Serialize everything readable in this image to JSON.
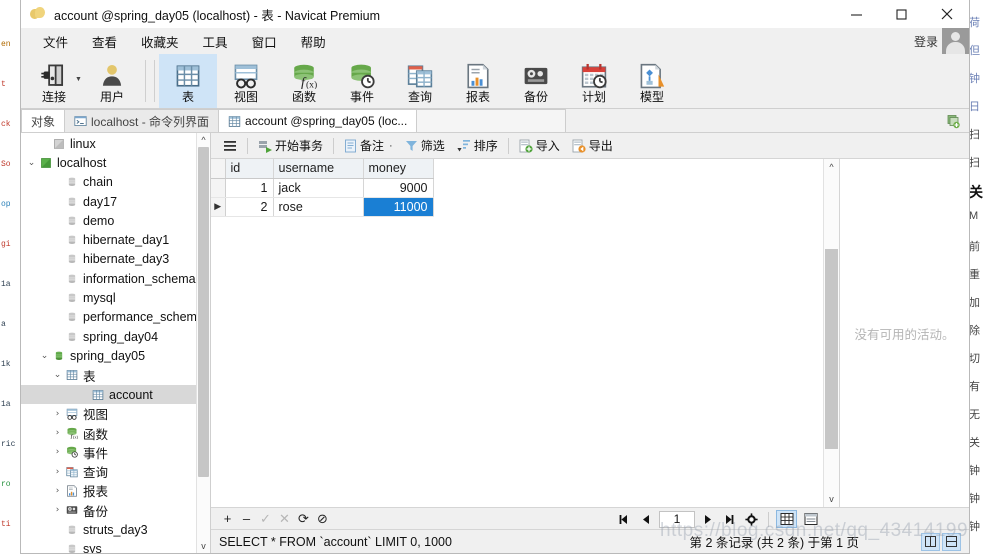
{
  "window": {
    "title": "account @spring_day05 (localhost) - 表 - Navicat Premium",
    "app_icon": "navicat-logo-icon",
    "minimize": "–",
    "maximize": "□",
    "close": "✕"
  },
  "menubar": {
    "items": [
      "文件",
      "查看",
      "收藏夹",
      "工具",
      "窗口",
      "帮助"
    ],
    "login_label": "登录",
    "avatar": "user-avatar-icon"
  },
  "ribbon": {
    "items": [
      {
        "label": "连接",
        "icon": "connection-icon",
        "selected": false,
        "has_caret": true
      },
      {
        "label": "用户",
        "icon": "user-icon",
        "selected": false,
        "has_caret": false
      },
      {
        "label": "表",
        "icon": "table-icon",
        "selected": true,
        "has_caret": false
      },
      {
        "label": "视图",
        "icon": "view-icon",
        "selected": false,
        "has_caret": false
      },
      {
        "label": "函数",
        "icon": "function-icon",
        "selected": false,
        "has_caret": false
      },
      {
        "label": "事件",
        "icon": "event-icon",
        "selected": false,
        "has_caret": false
      },
      {
        "label": "查询",
        "icon": "query-icon",
        "selected": false,
        "has_caret": false
      },
      {
        "label": "报表",
        "icon": "report-icon",
        "selected": false,
        "has_caret": false
      },
      {
        "label": "备份",
        "icon": "backup-icon",
        "selected": false,
        "has_caret": false
      },
      {
        "label": "计划",
        "icon": "schedule-icon",
        "selected": false,
        "has_caret": false
      },
      {
        "label": "模型",
        "icon": "model-icon",
        "selected": false,
        "has_caret": false
      }
    ]
  },
  "tabs": {
    "items": [
      {
        "label": "对象",
        "icon": "none",
        "active": false
      },
      {
        "label": "localhost - 命令列界面",
        "icon": "console-icon",
        "active": false
      },
      {
        "label": "account @spring_day05 (loc...",
        "icon": "table-icon",
        "active": true
      }
    ],
    "new_tab_icon": "new-tab-icon"
  },
  "sidebar": {
    "nodes": [
      {
        "label": "linux",
        "indent": 1,
        "chevron": "",
        "icon": "server-gray-icon",
        "selected": false
      },
      {
        "label": "localhost",
        "indent": 0,
        "chevron": "v",
        "icon": "server-green-icon",
        "selected": false
      },
      {
        "label": "chain",
        "indent": 2,
        "chevron": "",
        "icon": "db-gray-icon",
        "selected": false
      },
      {
        "label": "day17",
        "indent": 2,
        "chevron": "",
        "icon": "db-gray-icon",
        "selected": false
      },
      {
        "label": "demo",
        "indent": 2,
        "chevron": "",
        "icon": "db-gray-icon",
        "selected": false
      },
      {
        "label": "hibernate_day1",
        "indent": 2,
        "chevron": "",
        "icon": "db-gray-icon",
        "selected": false
      },
      {
        "label": "hibernate_day3",
        "indent": 2,
        "chevron": "",
        "icon": "db-gray-icon",
        "selected": false
      },
      {
        "label": "information_schema",
        "indent": 2,
        "chevron": "",
        "icon": "db-gray-icon",
        "selected": false
      },
      {
        "label": "mysql",
        "indent": 2,
        "chevron": "",
        "icon": "db-gray-icon",
        "selected": false
      },
      {
        "label": "performance_schema",
        "indent": 2,
        "chevron": "",
        "icon": "db-gray-icon",
        "selected": false
      },
      {
        "label": "spring_day04",
        "indent": 2,
        "chevron": "",
        "icon": "db-gray-icon",
        "selected": false
      },
      {
        "label": "spring_day05",
        "indent": 1,
        "chevron": "v",
        "icon": "db-green-icon",
        "selected": false
      },
      {
        "label": "表",
        "indent": 2,
        "chevron": "v",
        "icon": "table-icon",
        "selected": false
      },
      {
        "label": "account",
        "indent": 4,
        "chevron": "",
        "icon": "table-icon",
        "selected": true
      },
      {
        "label": "视图",
        "indent": 2,
        "chevron": ">",
        "icon": "view-icon",
        "selected": false
      },
      {
        "label": "函数",
        "indent": 2,
        "chevron": ">",
        "icon": "function-icon",
        "selected": false
      },
      {
        "label": "事件",
        "indent": 2,
        "chevron": ">",
        "icon": "event-icon",
        "selected": false
      },
      {
        "label": "查询",
        "indent": 2,
        "chevron": ">",
        "icon": "query-icon",
        "selected": false
      },
      {
        "label": "报表",
        "indent": 2,
        "chevron": ">",
        "icon": "report-icon",
        "selected": false
      },
      {
        "label": "备份",
        "indent": 2,
        "chevron": ">",
        "icon": "backup-icon",
        "selected": false
      },
      {
        "label": "struts_day3",
        "indent": 2,
        "chevron": "",
        "icon": "db-gray-icon",
        "selected": false
      },
      {
        "label": "sys",
        "indent": 2,
        "chevron": "",
        "icon": "db-gray-icon",
        "selected": false
      }
    ],
    "scroll_up": "^",
    "scroll_down": "v"
  },
  "grid_toolbar": {
    "menu_icon": "hamburger-icon",
    "buttons": [
      {
        "label": "开始事务",
        "icon": "start-transaction-icon"
      },
      {
        "label": "备注",
        "icon": "note-icon",
        "caret": "·"
      },
      {
        "label": "筛选",
        "icon": "filter-icon"
      },
      {
        "label": "排序",
        "icon": "sort-icon"
      },
      {
        "label": "导入",
        "icon": "import-icon"
      },
      {
        "label": "导出",
        "icon": "export-icon"
      }
    ]
  },
  "grid": {
    "columns": [
      "id",
      "username",
      "money"
    ],
    "rows": [
      {
        "marker": "",
        "id": "1",
        "username": "jack",
        "money": "9000",
        "selected_cell": null
      },
      {
        "marker": "▶",
        "id": "2",
        "username": "rose",
        "money": "11000",
        "selected_cell": "money"
      }
    ]
  },
  "activity_panel": {
    "message": "没有可用的活动。"
  },
  "rowbar": {
    "buttons": [
      {
        "icon": "plus-icon",
        "label": "+",
        "disabled": false
      },
      {
        "icon": "minus-icon",
        "label": "–",
        "disabled": false
      },
      {
        "icon": "check-icon",
        "label": "✓",
        "disabled": true
      },
      {
        "icon": "cancel-icon",
        "label": "✕",
        "disabled": true
      },
      {
        "icon": "refresh-icon",
        "label": "⟳",
        "disabled": false
      },
      {
        "icon": "stop-icon",
        "label": "⊘",
        "disabled": false
      }
    ],
    "pager": {
      "first": "first-page-icon",
      "prev": "prev-page-icon",
      "page_value": "1",
      "next": "next-page-icon",
      "last": "last-page-icon",
      "settings": "gear-icon",
      "grid_view": "grid-view-icon",
      "form_view": "form-view-icon",
      "grid_view_active": true
    }
  },
  "statusbar": {
    "sql": "SELECT * FROM `account` LIMIT 0, 1000",
    "record_info": "第 2 条记录 (共 2 条) 于第 1 页",
    "right_buttons": [
      "grid-layout-icon",
      "split-layout-icon"
    ]
  },
  "watermark": {
    "text": "https://blog.csdn.net/qq_43414199"
  },
  "background": {
    "left_lines": [
      "en",
      "t",
      "ck",
      "So",
      "op",
      "gi",
      "1a",
      "a",
      "1k",
      "1a",
      "ric",
      "ro",
      "ti"
    ],
    "right_lines": [
      "荷",
      "但",
      "钟",
      "日",
      "扫",
      "扫",
      "关",
      "M",
      "前",
      "重",
      "加",
      "除",
      "切",
      "有",
      "无",
      "关",
      "钟",
      "钟",
      "钟"
    ]
  },
  "colors": {
    "accent_blue": "#1a7fd4",
    "ribbon_selected": "#cfe4f7",
    "header_bg": "#eef2f5",
    "chrome_bg": "#f0f0f0",
    "green": "#5a9e3f",
    "orange": "#e8902a"
  }
}
